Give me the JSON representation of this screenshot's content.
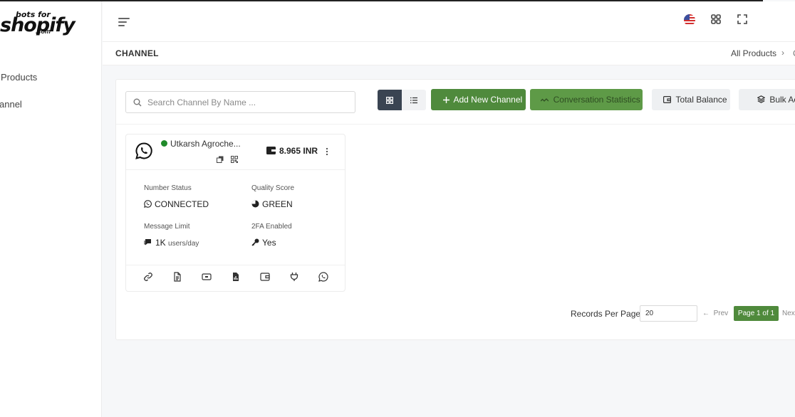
{
  "brand": {
    "top": "bots for",
    "main": "shopify",
    "sub": ".com"
  },
  "sidebar": {
    "items": [
      {
        "label": "Products"
      },
      {
        "label": "annel"
      }
    ]
  },
  "page": {
    "title": "CHANNEL"
  },
  "breadcrumb": {
    "root": "All Products",
    "separator": "›",
    "current": "C"
  },
  "search": {
    "placeholder": "Search Channel By Name ..."
  },
  "toolbar": {
    "add_label": "Add New Channel",
    "stats_label": "Conversation Statistics",
    "balance_label": "Total Balance",
    "bulk_label": "Bulk Actio"
  },
  "channel": {
    "name": "Utkarsh Agroche...",
    "balance": "8.965 INR",
    "number_status_label": "Number Status",
    "number_status": "CONNECTED",
    "quality_label": "Quality Score",
    "quality": "GREEN",
    "limit_label": "Message Limit",
    "limit_value": "1K",
    "limit_unit": "users/day",
    "twofa_label": "2FA Enabled",
    "twofa_value": "Yes"
  },
  "pagination": {
    "records_label": "Records Per Page",
    "records_value": "20",
    "prev": "Prev",
    "page": "Page 1 of 1",
    "next": "Next"
  },
  "colors": {
    "accent": "#4f8a3c",
    "online": "#1f8a2a",
    "dark": "#3a4452"
  }
}
